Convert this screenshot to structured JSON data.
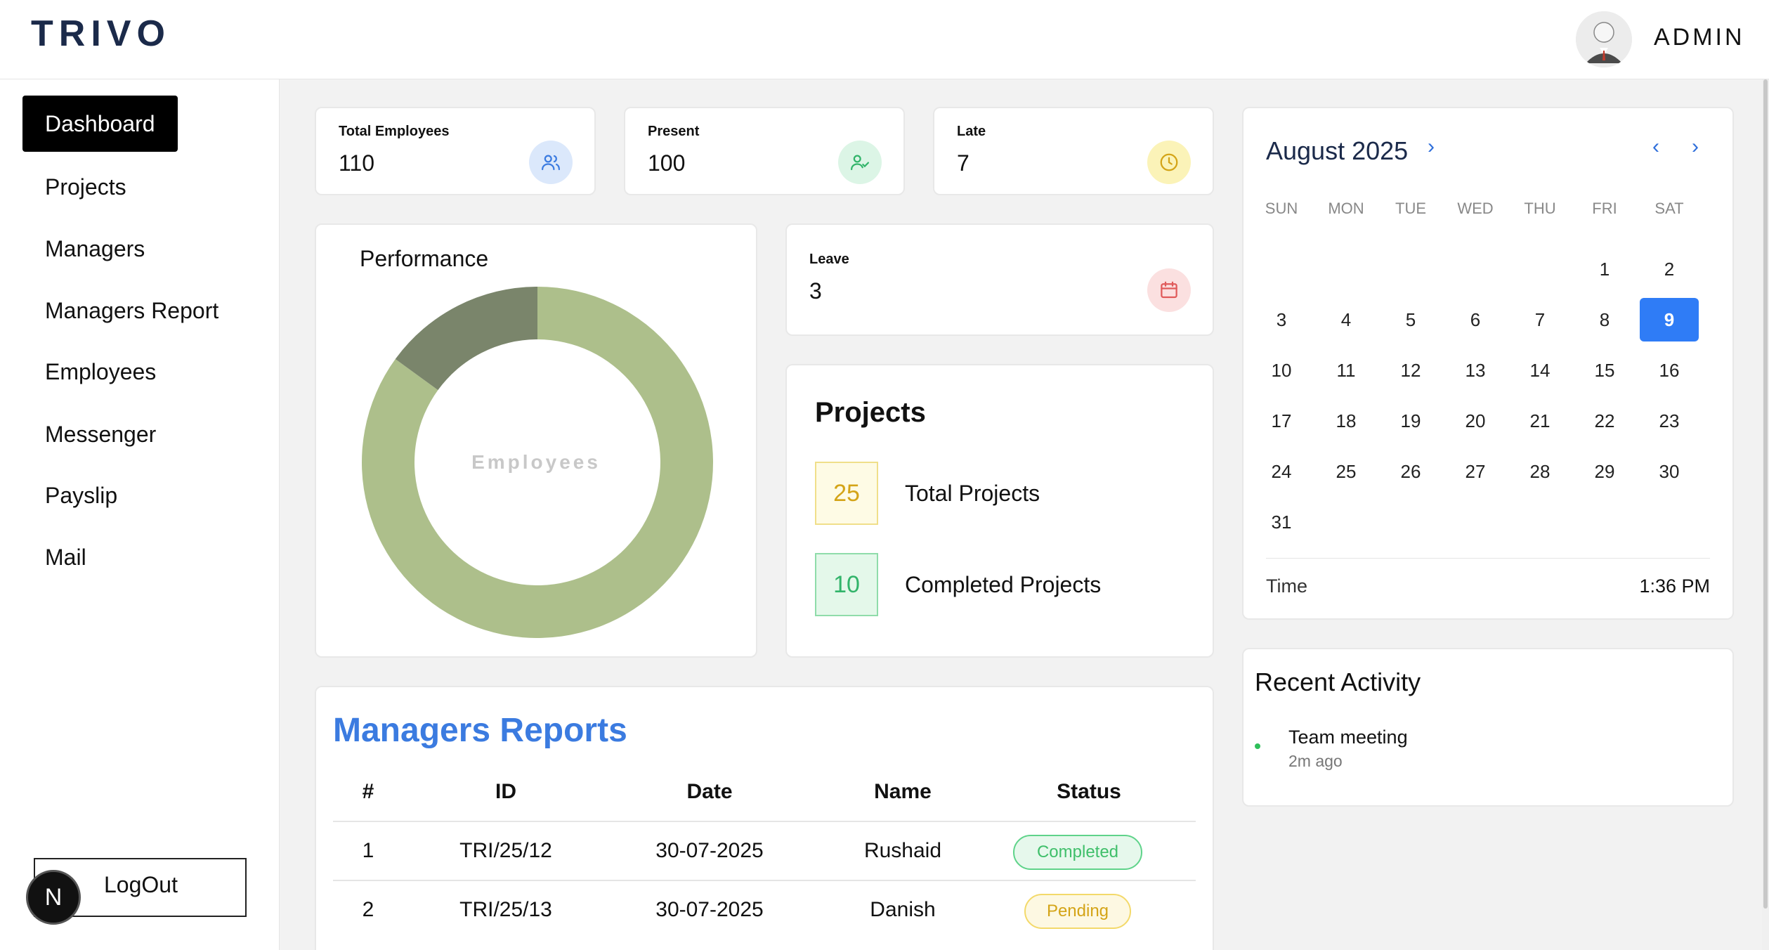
{
  "header": {
    "logo": "TRIVO",
    "user": "ADMIN"
  },
  "sidebar": {
    "items": [
      {
        "label": "Dashboard"
      },
      {
        "label": "Projects"
      },
      {
        "label": "Managers"
      },
      {
        "label": "Managers Report"
      },
      {
        "label": "Employees"
      },
      {
        "label": "Messenger"
      },
      {
        "label": "Payslip"
      },
      {
        "label": "Mail"
      }
    ],
    "active_index": 0,
    "logout": "LogOut",
    "badge": "N"
  },
  "stats": {
    "total_employees": {
      "title": "Total Employees",
      "value": "110",
      "icon": "users-icon"
    },
    "present": {
      "title": "Present",
      "value": "100",
      "icon": "user-check-icon"
    },
    "late": {
      "title": "Late",
      "value": "7",
      "icon": "clock-icon"
    },
    "leave": {
      "title": "Leave",
      "value": "3",
      "icon": "calendar-icon"
    }
  },
  "performance": {
    "title": "Performance",
    "center_label": "Employees",
    "segments": [
      {
        "value": 85,
        "color": "#adbf8b"
      },
      {
        "value": 15,
        "color": "#7a856b"
      }
    ]
  },
  "projects": {
    "title": "Projects",
    "total": {
      "value": "25",
      "label": "Total Projects"
    },
    "completed": {
      "value": "10",
      "label": "Completed Projects"
    }
  },
  "calendar": {
    "month_label": "August 2025",
    "days_of_week": [
      "SUN",
      "MON",
      "TUE",
      "WED",
      "THU",
      "FRI",
      "SAT"
    ],
    "days": [
      "1",
      "2",
      "3",
      "4",
      "5",
      "6",
      "7",
      "8",
      "9",
      "10",
      "11",
      "12",
      "13",
      "14",
      "15",
      "16",
      "17",
      "18",
      "19",
      "20",
      "21",
      "22",
      "23",
      "24",
      "25",
      "26",
      "27",
      "28",
      "29",
      "30",
      "31"
    ],
    "today": "9",
    "time_label": "Time",
    "time_value": "1:36 PM"
  },
  "activity": {
    "title": "Recent Activity",
    "items": [
      {
        "name": "Team meeting",
        "time": "2m ago"
      }
    ]
  },
  "managers_reports": {
    "title": "Managers Reports",
    "columns": [
      "#",
      "ID",
      "Date",
      "Name",
      "Status"
    ],
    "rows": [
      {
        "num": "1",
        "id": "TRI/25/12",
        "date": "30-07-2025",
        "name": "Rushaid",
        "status": "Completed"
      },
      {
        "num": "2",
        "id": "TRI/25/13",
        "date": "30-07-2025",
        "name": "Danish",
        "status": "Pending"
      }
    ]
  },
  "colors": {
    "accent": "#2f7cf6",
    "title_blue": "#3b7be0",
    "brand": "#1b2a4a"
  }
}
